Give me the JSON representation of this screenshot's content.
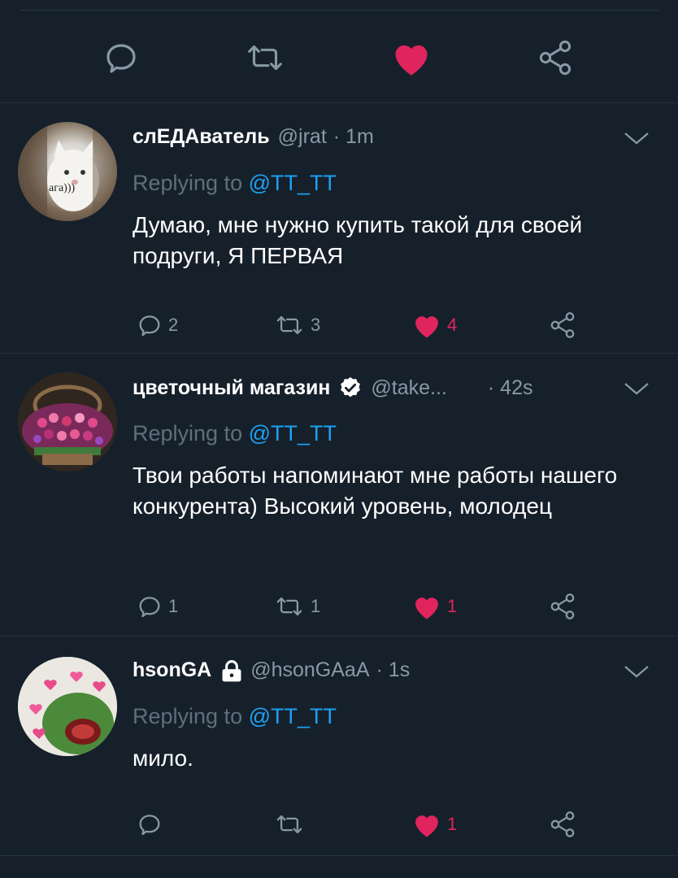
{
  "colors": {
    "background": "#16202b",
    "accent": "#1da1f2",
    "like": "#e0245e",
    "muted": "#8899a6"
  },
  "top_actions": {
    "reply_icon": "reply-icon",
    "retweet_icon": "retweet-icon",
    "like_icon": "heart-filled-icon",
    "share_icon": "share-icon"
  },
  "replies": [
    {
      "display_name": "слЕДАватель",
      "handle": "@jrat",
      "time": "· 1m",
      "replying_prefix": "Replying to ",
      "replying_to": "@TT_TT",
      "text": "Думаю, мне нужно купить такой для своей подруги, Я ПЕРВАЯ",
      "avatar_caption": "ага)))",
      "reply_count": "2",
      "retweet_count": "3",
      "like_count": "4",
      "liked": true
    },
    {
      "display_name": "цветочный магазин",
      "handle": "@take...",
      "time": "· 42s",
      "replying_prefix": "Replying to ",
      "replying_to": "@TT_TT",
      "text": "Твои работы напоминают мне работы нашего конкурента) Высокий уровень, молодец",
      "verified": true,
      "reply_count": "1",
      "retweet_count": "1",
      "like_count": "1",
      "liked": true
    },
    {
      "display_name": "hsonGA",
      "handle": "@hsonGAaA",
      "time": "· 1s",
      "replying_prefix": "Replying to ",
      "replying_to": "@TT_TT",
      "text": "мило.",
      "protected": true,
      "reply_count": "",
      "retweet_count": "",
      "like_count": "1",
      "liked": true
    }
  ]
}
